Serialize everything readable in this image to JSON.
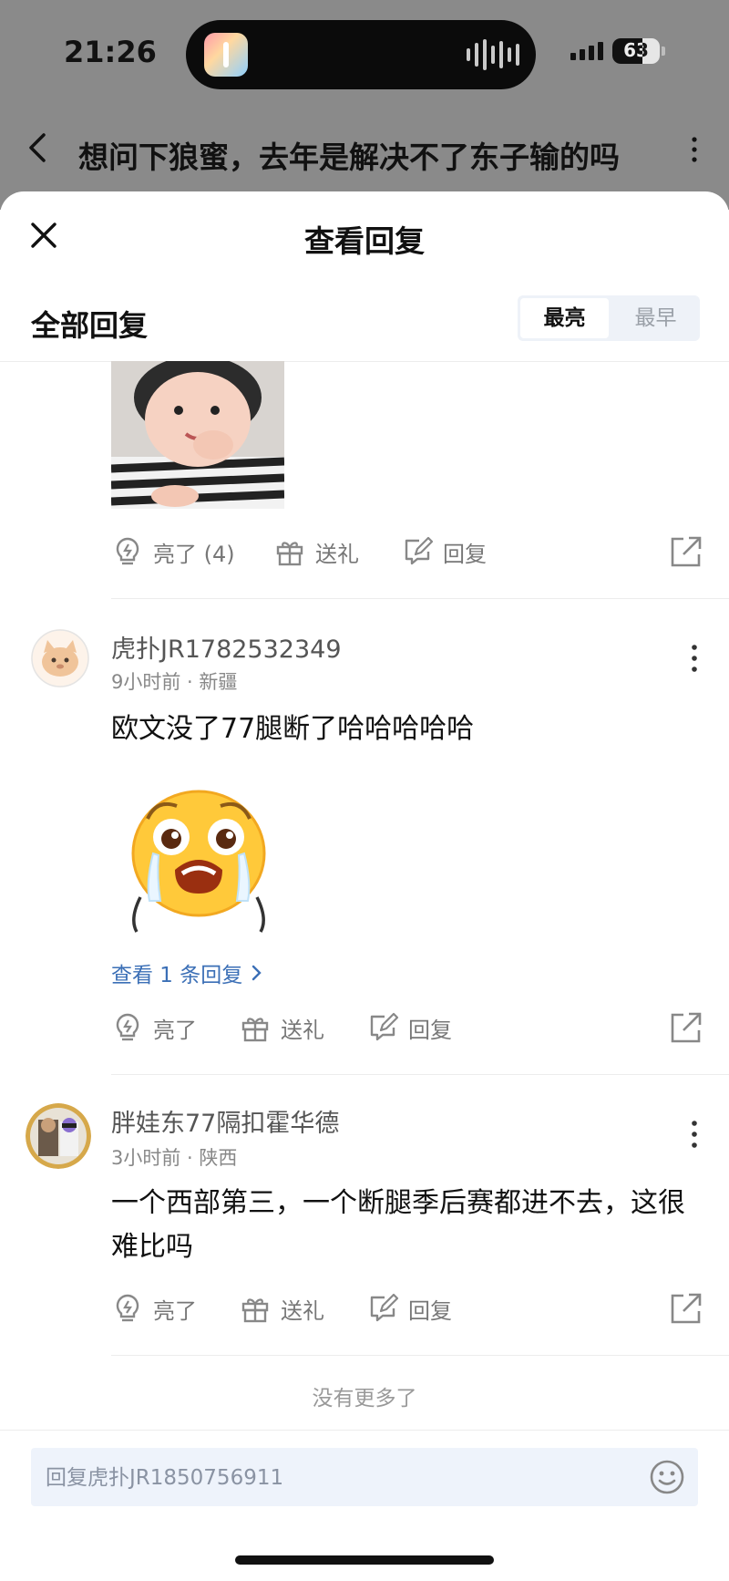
{
  "status_bar": {
    "time": "21:26",
    "battery": "63"
  },
  "nav": {
    "title": "想问下狼蜜，去年是解决不了东子输的吗"
  },
  "sheet": {
    "title": "查看回复",
    "section_title": "全部回复",
    "sort_tabs": [
      "最亮",
      "最早"
    ]
  },
  "first_comment_actions": {
    "like": "亮了 (4)",
    "gift": "送礼",
    "reply": "回复"
  },
  "comments": [
    {
      "user": "虎扑JR1782532349",
      "meta": "9小时前 · 新疆",
      "text": "欧文没了77腿断了哈哈哈哈哈",
      "view_replies": "查看 1 条回复",
      "actions": {
        "like": "亮了",
        "gift": "送礼",
        "reply": "回复"
      }
    },
    {
      "user": "胖娃东77隔扣霍华德",
      "meta": "3小时前 · 陕西",
      "text": "一个西部第三，一个断腿季后赛都进不去，这很难比吗",
      "actions": {
        "like": "亮了",
        "gift": "送礼",
        "reply": "回复"
      }
    }
  ],
  "end_text": "没有更多了",
  "input": {
    "placeholder": "回复虎扑JR1850756911"
  },
  "icons": [
    "back-icon",
    "more-icon",
    "close-icon",
    "lightbulb-icon",
    "gift-icon",
    "edit-icon",
    "share-icon",
    "chevron-right-icon",
    "emoji-icon"
  ]
}
